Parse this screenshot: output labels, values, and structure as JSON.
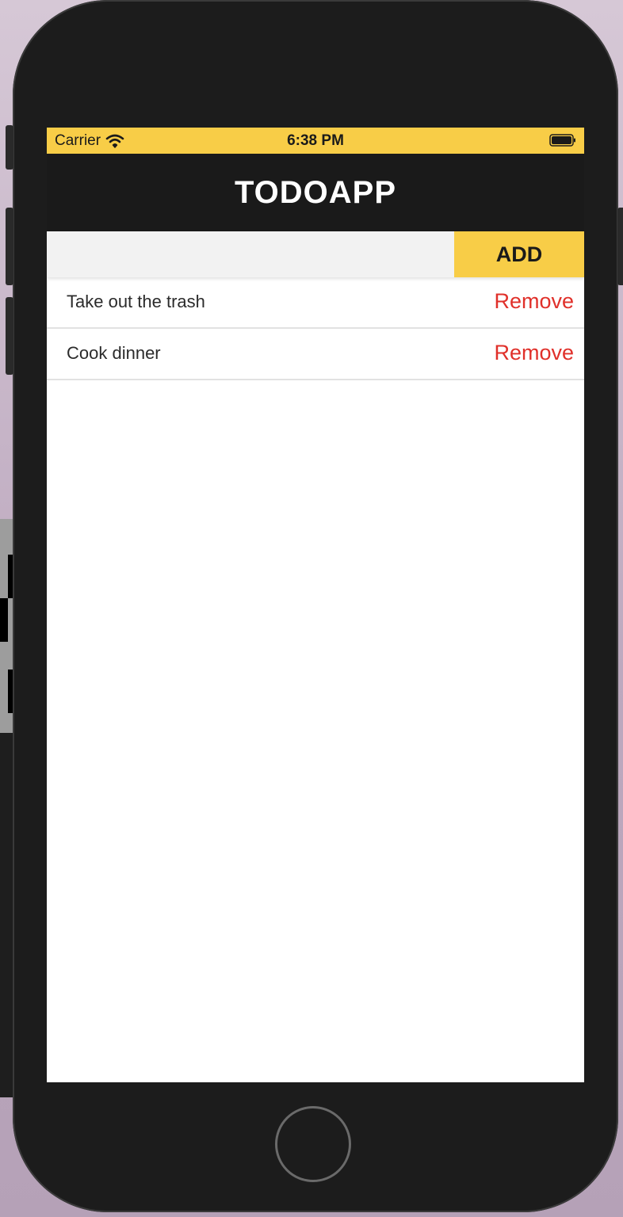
{
  "status_bar": {
    "carrier": "Carrier",
    "time": "6:38 PM",
    "wifi_icon": "wifi-icon",
    "battery_icon": "battery-icon"
  },
  "header": {
    "title": "TODOAPP"
  },
  "input": {
    "value": "",
    "placeholder": "",
    "add_label": "ADD"
  },
  "todos": [
    {
      "text": "Take out the trash",
      "remove_label": "Remove"
    },
    {
      "text": "Cook dinner",
      "remove_label": "Remove"
    }
  ],
  "colors": {
    "accent": "#f8cd47",
    "header_bg": "#1a1a1a",
    "remove": "#e0302a"
  }
}
